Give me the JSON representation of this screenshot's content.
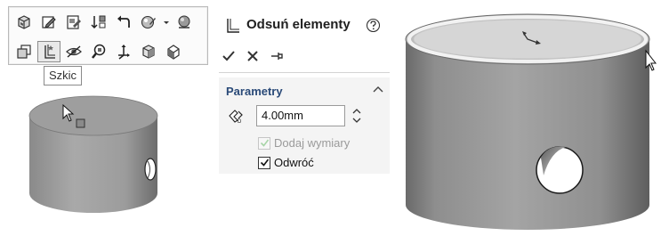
{
  "toolbar": {
    "tooltip": "Szkic",
    "row1_icons": [
      "view-orientation-icon",
      "edit-sketch-icon",
      "edit-feature-icon",
      "sort-icon",
      "undo-arrow-icon",
      "appearance-icon",
      "appearance-dropdown-icon",
      "plane-icon"
    ],
    "row2_icons": [
      "normal-to-icon",
      "sketch-icon",
      "hide-icon",
      "zoom-to-selection-icon",
      "move-triad-icon",
      "view-cube-icon",
      "section-view-icon"
    ],
    "active_icon": "sketch-icon"
  },
  "property_manager": {
    "title": "Odsuń elementy",
    "section": {
      "title": "Parametry",
      "distance_value": "4.00mm",
      "checkboxes": [
        {
          "label": "Dodaj wymiary",
          "checked": true,
          "enabled": false
        },
        {
          "label": "Odwróć",
          "checked": true,
          "enabled": true
        }
      ]
    }
  },
  "colors": {
    "body_gray": "#a0a0a0",
    "body_dark": "#6f6f6f",
    "face_light": "#d2d2d2",
    "accent_blue": "#2a4a78",
    "check_green": "#3c8a3c"
  }
}
